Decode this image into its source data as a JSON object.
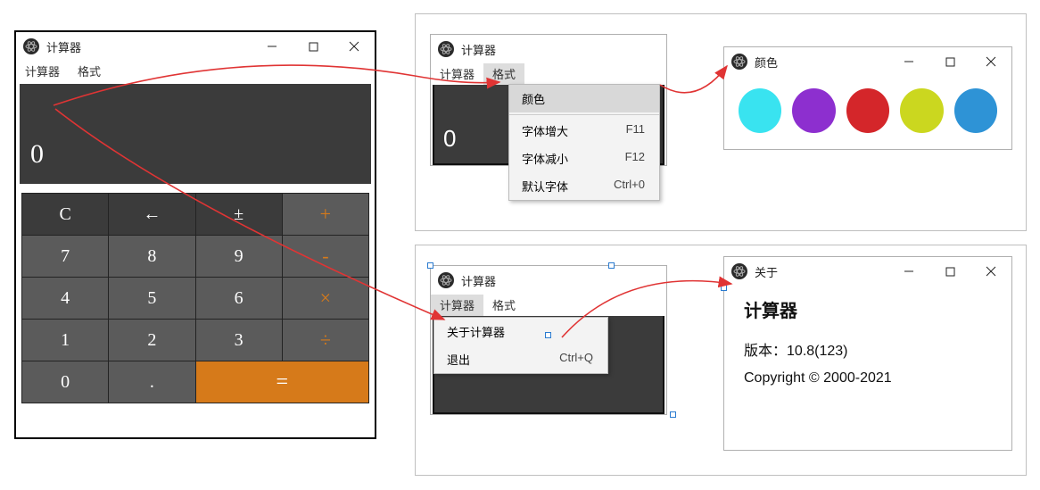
{
  "app": {
    "title": "计算器"
  },
  "menubar": {
    "calculator": "计算器",
    "format": "格式"
  },
  "display": {
    "value": "0"
  },
  "keys": {
    "c": "C",
    "back": "←",
    "pm": "±",
    "plus": "+",
    "7": "7",
    "8": "8",
    "9": "9",
    "minus": "-",
    "4": "4",
    "5": "5",
    "6": "6",
    "times": "×",
    "1": "1",
    "2": "2",
    "3": "3",
    "div": "÷",
    "0": "0",
    "dot": ".",
    "eq": "="
  },
  "format_menu": {
    "color": {
      "label": "颜色"
    },
    "font_bigger": {
      "label": "字体增大",
      "accel": "F11"
    },
    "font_smaller": {
      "label": "字体减小",
      "accel": "F12"
    },
    "font_default": {
      "label": "默认字体",
      "accel": "Ctrl+0"
    }
  },
  "calc_menu": {
    "about": {
      "label": "关于计算器"
    },
    "quit": {
      "label": "退出",
      "accel": "Ctrl+Q"
    }
  },
  "color_window": {
    "title": "颜色",
    "swatches": [
      "#39e3f0",
      "#8d2fcf",
      "#d4262a",
      "#cbd71f",
      "#2e93d6"
    ]
  },
  "about_window": {
    "title": "关于",
    "heading": "计算器",
    "version_label": "版本：",
    "version_value": "10.8(123)",
    "copyright": "Copyright © 2000-2021"
  }
}
